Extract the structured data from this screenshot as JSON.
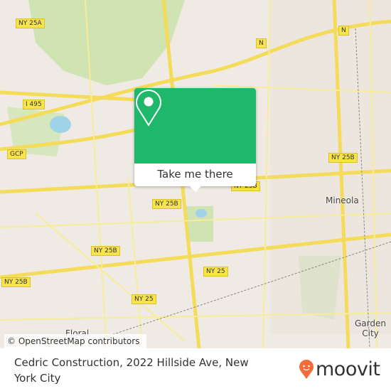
{
  "map": {
    "route_labels": [
      "NY 25A",
      "N",
      "N",
      "I 495",
      "GCP",
      "NY 25B",
      "NY 25B",
      "NY 25B",
      "NY 25B",
      "NY 25B",
      "NY 25",
      "NY 25"
    ],
    "places": [
      "Mineola",
      "Garden City",
      "Floral"
    ],
    "attribution": "© OpenStreetMap contributors",
    "colors": {
      "land": "#efebe4",
      "park": "#cfe3b3",
      "road": "#f7e34a",
      "water": "#9fd3e8"
    }
  },
  "popup": {
    "icon": "map-pin-icon",
    "button_label": "Take me there",
    "color": "#1fb86a"
  },
  "footer": {
    "title": "Cedric Construction, 2022 Hillside Ave, New York City",
    "logo_text": "moovit",
    "logo_color": "#f26b3a"
  }
}
